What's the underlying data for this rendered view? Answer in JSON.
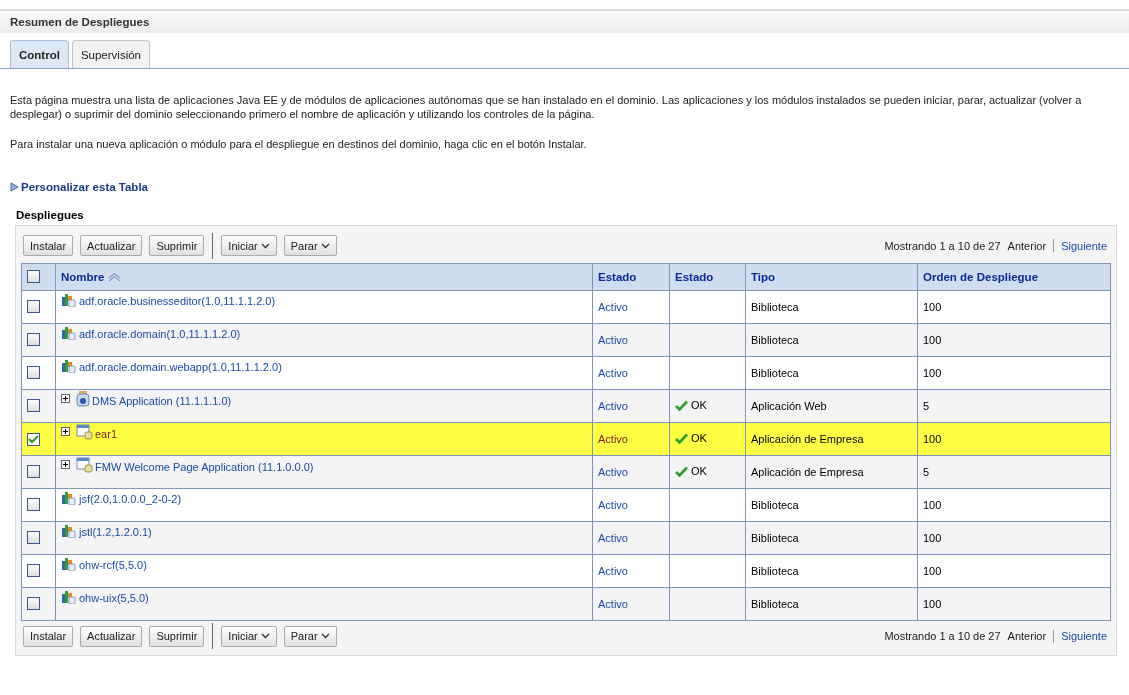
{
  "panel": {
    "title": "Resumen de Despliegues"
  },
  "tabs": [
    {
      "label": "Control",
      "selected": true
    },
    {
      "label": "Supervisión",
      "selected": false
    }
  ],
  "description": [
    "Esta página muestra una lista de aplicaciones Java EE y de módulos de aplicaciones autónomas que se han instalado en el dominio. Las aplicaciones y los módulos instalados se pueden iniciar, parar, actualizar (volver a desplegar) o suprimir del dominio seleccionando primero el nombre de aplicación y utilizando los controles de la página.",
    "Para instalar una nueva aplicación o módulo para el despliegue en destinos del dominio, haga clic en el botón Instalar."
  ],
  "customize_link": "Personalizar esta Tabla",
  "table_title": "Despliegues",
  "toolbar_top": {
    "buttons": [
      "Instalar",
      "Actualizar",
      "Suprimir"
    ],
    "menus": [
      "Iniciar",
      "Parar"
    ],
    "range": "Mostrando 1 a 10 de 27",
    "previous": "Anterior",
    "next": "Siguiente"
  },
  "table": {
    "columns": [
      "Nombre",
      "Estado",
      "Estado",
      "Tipo",
      "Orden de Despliegue"
    ],
    "header_checked": false,
    "rows": [
      {
        "kind": "library",
        "expandable": false,
        "name": "adf.oracle.businesseditor(1.0,11.1.1.2.0)",
        "state": "Activo",
        "health": "",
        "type": "Biblioteca",
        "order": "100",
        "selected": false
      },
      {
        "kind": "library",
        "expandable": false,
        "name": "adf.oracle.domain(1.0,11.1.1.2.0)",
        "state": "Activo",
        "health": "",
        "type": "Biblioteca",
        "order": "100",
        "selected": false
      },
      {
        "kind": "library",
        "expandable": false,
        "name": "adf.oracle.domain.webapp(1.0,11.1.1.2.0)",
        "state": "Activo",
        "health": "",
        "type": "Biblioteca",
        "order": "100",
        "selected": false
      },
      {
        "kind": "webapp",
        "expandable": true,
        "name": "DMS Application (11.1.1.1.0)",
        "state": "Activo",
        "health": "OK",
        "type": "Aplicación Web",
        "order": "5",
        "selected": false
      },
      {
        "kind": "ear",
        "expandable": true,
        "name": "ear1",
        "state": "Activo",
        "health": "OK",
        "type": "Aplicación de Empresa",
        "order": "100",
        "selected": true
      },
      {
        "kind": "ear",
        "expandable": true,
        "name": "FMW Welcome Page Application (11.1.0.0.0)",
        "state": "Activo",
        "health": "OK",
        "type": "Aplicación de Empresa",
        "order": "5",
        "selected": false
      },
      {
        "kind": "library",
        "expandable": false,
        "name": "jsf(2.0,1.0.0.0_2-0-2)",
        "state": "Activo",
        "health": "",
        "type": "Biblioteca",
        "order": "100",
        "selected": false
      },
      {
        "kind": "library",
        "expandable": false,
        "name": "jstl(1.2,1.2.0.1)",
        "state": "Activo",
        "health": "",
        "type": "Biblioteca",
        "order": "100",
        "selected": false
      },
      {
        "kind": "library",
        "expandable": false,
        "name": "ohw-rcf(5,5.0)",
        "state": "Activo",
        "health": "",
        "type": "Biblioteca",
        "order": "100",
        "selected": false
      },
      {
        "kind": "library",
        "expandable": false,
        "name": "ohw-uix(5,5.0)",
        "state": "Activo",
        "health": "",
        "type": "Biblioteca",
        "order": "100",
        "selected": false
      }
    ]
  },
  "toolbar_bottom": {
    "buttons": [
      "Instalar",
      "Actualizar",
      "Suprimir"
    ],
    "menus": [
      "Iniciar",
      "Parar"
    ],
    "range": "Mostrando 1 a 10 de 27",
    "previous": "Anterior",
    "next": "Siguiente"
  }
}
